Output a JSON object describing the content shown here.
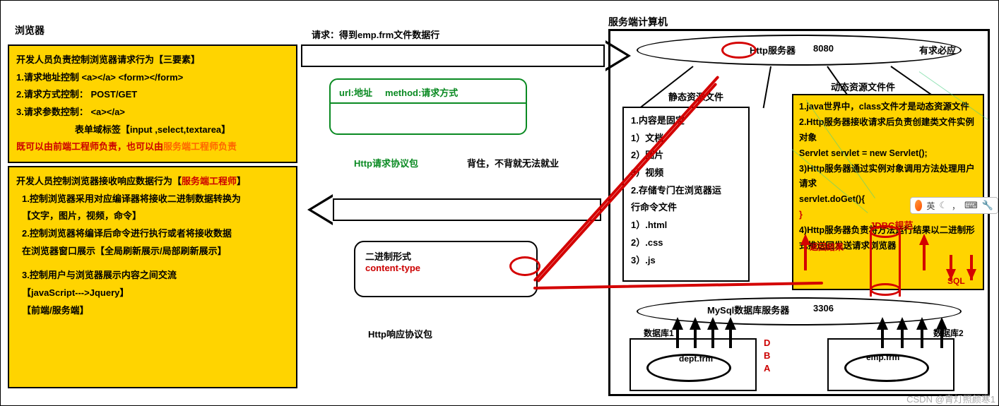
{
  "labels": {
    "browser": "浏览器",
    "server_computer": "服务端计算机",
    "request_line": "请求：得到emp.frm文件数据行",
    "http_req_pkg": "Http请求协议包",
    "remember": "背住，不背就无法就业",
    "http_resp_pkg": "Http响应协议包",
    "http_server": "Http服务器",
    "port_8080": "8080",
    "youqiu": "有求必应",
    "static_res": "静态资源文件",
    "dynamic_res": "动态资源文件件",
    "mysql_server": "MySql数据库服务器",
    "port_3306": "3306",
    "db1": "数据库1",
    "db2": "数据库2",
    "frm1": "dept.frm",
    "frm2": "emp.frm",
    "dba": "D\nB\nA",
    "jdbc": "JDBC规范",
    "return_result": "返回结果",
    "sql": "SQL"
  },
  "box1": {
    "l1": "开发人员负责控制浏览器请求行为【三要素】",
    "l2": "1.请求地址控制   <a></a>   <form></form>",
    "l3": "2.请求方式控制： POST/GET",
    "l4": "3.请求参数控制： <a></a>",
    "l5": "表单域标签【input ,select,textarea】",
    "l6a": "既可以由前端工程师负责，也可以由",
    "l6b": "服务端工程师负责"
  },
  "box2": {
    "l1a": "开发人员控制浏览器接收响应数据行为【",
    "l1b": "服务端工程师",
    "l1c": "】",
    "l2": "1.控制浏览器采用对应编译器将接收二进制数据转换为",
    "l3": "【文字，图片，视频，命令】",
    "l4": "2.控制浏览器将编译后命令进行执行或者将接收数据",
    "l5": "在浏览器窗口展示【全局刷新展示/局部刷新展示】",
    "l6": "3.控制用户与浏览器展示内容之间交流",
    "l7": "【javaScript--->Jquery】",
    "l8": "【前端/服务端】"
  },
  "green": {
    "url": "url:地址",
    "method": "method:请求方式"
  },
  "binary": {
    "l1": "二进制形式",
    "l2": "content-type"
  },
  "static_box": {
    "l1": "1.内容是固定",
    "l2": "1）文档",
    "l3": "2）图片",
    "l4": "3）视频",
    "l5": "2.存储专门在浏览器运",
    "l6": "行命令文件",
    "l7": "1）.html",
    "l8": "2）.css",
    "l9": "3）.js"
  },
  "dynamic_box": {
    "l1": "1.java世界中，class文件才是动态资源文件",
    "l2": "2.Http服务器接收请求后负责创建类文件实例",
    "l3": "对象",
    "l4": "Servlet servlet = new Servlet();",
    "l5": "3)Http服务器通过实例对象调用方法处理用户",
    "l6": "请求",
    "l7": "servlet.doGet(){",
    "l8": "}",
    "l9": "4)Http服务器负责将方法运行结果以二进制形",
    "l10": "式推送回发送请求浏览器"
  },
  "ime": {
    "lang": "英"
  },
  "watermark": "CSDN @青灯照颜寒1"
}
